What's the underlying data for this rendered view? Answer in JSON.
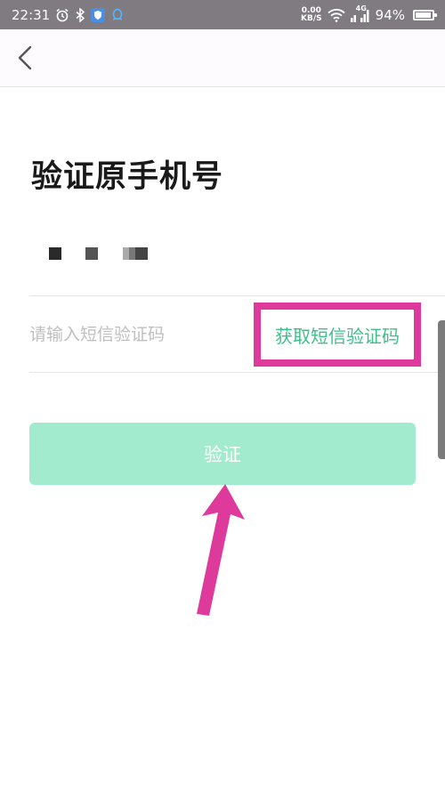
{
  "status_bar": {
    "time": "22:31",
    "net_speed_value": "0.00",
    "net_speed_unit": "KB/S",
    "network_type": "4G",
    "battery_percent": "94%",
    "battery_level": 0.94,
    "icons": [
      "alarm-icon",
      "bluetooth-icon",
      "shield-icon",
      "qq-icon",
      "wifi-icon",
      "signal-icon",
      "battery-icon"
    ]
  },
  "nav": {
    "back_icon": "chevron-left-icon"
  },
  "page": {
    "title": "验证原手机号",
    "code_input_placeholder": "请输入短信验证码",
    "get_code_label": "获取短信验证码",
    "verify_label": "验证"
  },
  "colors": {
    "accent": "#3fbf8a",
    "button_bg": "#a3ebcf",
    "annotation": "#de3a9c",
    "status_bar_bg": "#7f7b81"
  }
}
